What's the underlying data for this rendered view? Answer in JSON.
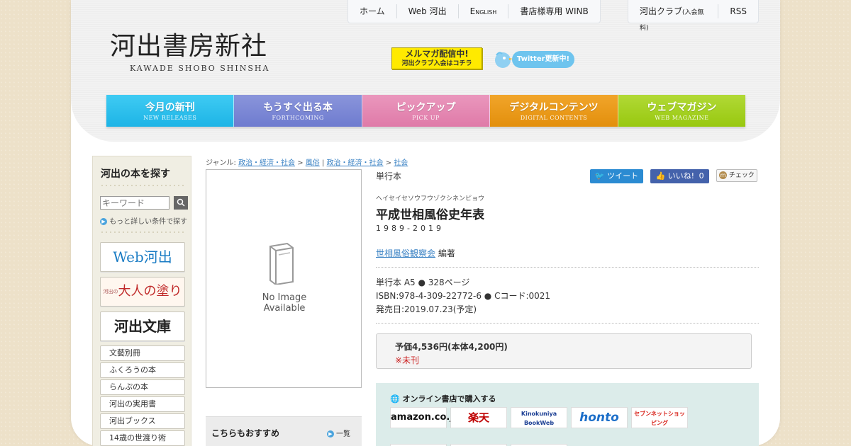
{
  "brand": {
    "name_jp": "河出書房新社",
    "name_en": "KAWADE SHOBO SHINSHA"
  },
  "top_nav": [
    {
      "label": "ホーム"
    },
    {
      "label": "Web 河出"
    },
    {
      "label": "English"
    },
    {
      "label": "書店様専用 WINB"
    }
  ],
  "top_nav2": {
    "club": "河出クラブ",
    "club_note": "(入会無料)",
    "rss": "RSS"
  },
  "mailmag": {
    "line1": "メルマガ配信中!",
    "line2": "河出クラブ入会はコチラ"
  },
  "twitter_banner": {
    "label": "Twitter更新中!"
  },
  "main_nav": [
    {
      "jp": "今月の新刊",
      "en": "NEW RELEASES",
      "color": "#29c0ee"
    },
    {
      "jp": "もうすぐ出る本",
      "en": "FORTHCOMING",
      "color": "#7a86d4"
    },
    {
      "jp": "ピックアップ",
      "en": "PICK UP",
      "color": "#e586b1"
    },
    {
      "jp": "デジタルコンテンツ",
      "en": "DIGITAL CONTENTS",
      "color": "#ec9b17"
    },
    {
      "jp": "ウェブマガジン",
      "en": "WEB MAGAZINE",
      "color": "#a5d11c"
    }
  ],
  "sidebar": {
    "title": "河出の本を探す",
    "search_placeholder": "キーワード",
    "more_search": "もっと詳しい条件で探す",
    "big_links": {
      "web_kawade": "Web河出",
      "nurie_small": "河出の",
      "nurie": "大人の塗り絵",
      "bunko": "河出文庫"
    },
    "links": [
      "文藝別冊",
      "ふくろうの本",
      "らんぷの本",
      "河出の実用書",
      "河出ブックス",
      "14歳の世渡り術"
    ]
  },
  "breadcrumb": {
    "prefix": "ジャンル:",
    "items": [
      "政治・経済・社会",
      "風俗",
      "政治・経済・社会",
      "社会"
    ]
  },
  "cover": {
    "line1": "No Image",
    "line2": "Available"
  },
  "recommend": {
    "title": "こちらもおすすめ",
    "list_link": "一覧"
  },
  "book": {
    "type": "単行本",
    "kana": "ヘイセイセソウフウゾクシネンピョウ",
    "title": "平成世相風俗史年表",
    "subtitle": "1989-2019",
    "author_link": "世相風俗観察会",
    "author_role": "編著",
    "spec1": "単行本 A5 ● 328ページ",
    "spec2": "ISBN:978-4-309-22772-6 ● Cコード:0021",
    "spec3": "発売日:2019.07.23(予定)",
    "price": "予価4,536円(本体4,200円)",
    "status": "※未刊"
  },
  "social": {
    "tweet": "ツイート",
    "like": "いいね!",
    "like_count": "0",
    "check": "チェック"
  },
  "shops": {
    "heading": "オンライン書店で購入する",
    "items": [
      "amazon.co.jp",
      "楽天",
      "Kinokuniya BookWeb",
      "honto",
      "セブンネットショッピング"
    ]
  }
}
